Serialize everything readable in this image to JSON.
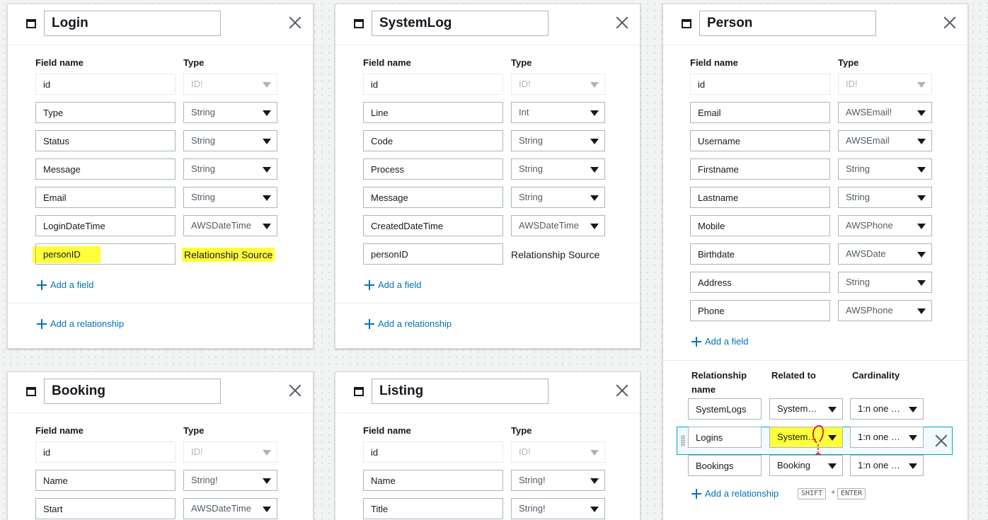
{
  "labels": {
    "field_name": "Field name",
    "type": "Type",
    "add_field": "Add a field",
    "add_relationship": "Add a relationship",
    "relationship_source": "Relationship Source"
  },
  "login": {
    "title": "Login",
    "fields": [
      {
        "name": "id",
        "type": "ID!"
      },
      {
        "name": "Type",
        "type": "String"
      },
      {
        "name": "Status",
        "type": "String"
      },
      {
        "name": "Message",
        "type": "String"
      },
      {
        "name": "Email",
        "type": "String"
      },
      {
        "name": "LoginDateTime",
        "type": "AWSDateTime"
      },
      {
        "name": "personID"
      }
    ]
  },
  "systemlog": {
    "title": "SystemLog",
    "fields": [
      {
        "name": "id",
        "type": "ID!"
      },
      {
        "name": "Line",
        "type": "Int"
      },
      {
        "name": "Code",
        "type": "String"
      },
      {
        "name": "Process",
        "type": "String"
      },
      {
        "name": "Message",
        "type": "String"
      },
      {
        "name": "CreatedDateTime",
        "type": "AWSDateTime"
      },
      {
        "name": "personID"
      }
    ]
  },
  "person": {
    "title": "Person",
    "fields": [
      {
        "name": "id",
        "type": "ID!"
      },
      {
        "name": "Email",
        "type": "AWSEmail!"
      },
      {
        "name": "Username",
        "type": "AWSEmail"
      },
      {
        "name": "Firstname",
        "type": "String"
      },
      {
        "name": "Lastname",
        "type": "String"
      },
      {
        "name": "Mobile",
        "type": "AWSPhone"
      },
      {
        "name": "Birthdate",
        "type": "AWSDate"
      },
      {
        "name": "Address",
        "type": "String"
      },
      {
        "name": "Phone",
        "type": "AWSPhone"
      }
    ],
    "rel_headers": {
      "name_line1": "Relationship",
      "name_line2": "name",
      "related_to": "Related to",
      "cardinality": "Cardinality"
    },
    "relationships": [
      {
        "name": "SystemLogs",
        "related": "System…",
        "cardinality": "1:n one …"
      },
      {
        "name": "Logins",
        "related": "System…",
        "cardinality": "1:n one …"
      },
      {
        "name": "Bookings",
        "related": "Booking",
        "cardinality": "1:n one …"
      }
    ],
    "shortcut": {
      "key1": "SHIFT",
      "plus": "+",
      "key2": "ENTER"
    }
  },
  "booking": {
    "title": "Booking",
    "fields": [
      {
        "name": "id",
        "type": "ID!"
      },
      {
        "name": "Name",
        "type": "String!"
      },
      {
        "name": "Start",
        "type": "AWSDateTime"
      }
    ]
  },
  "listing": {
    "title": "Listing",
    "fields": [
      {
        "name": "id",
        "type": "ID!"
      },
      {
        "name": "Name",
        "type": "String!"
      },
      {
        "name": "Title",
        "type": "String!"
      }
    ]
  },
  "colors": {
    "highlight": "#ffff3b",
    "link": "#0073bb",
    "annotation": "#e0001a",
    "active_row_border": "#00a1c9"
  }
}
